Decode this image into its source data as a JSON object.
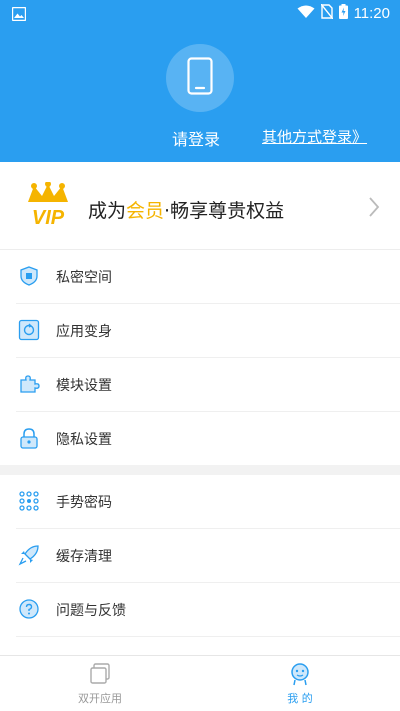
{
  "statusbar": {
    "time": "11:20"
  },
  "header": {
    "login_label": "请登录",
    "other_login_label": "其他方式登录》"
  },
  "vip": {
    "prefix": "成为",
    "highlight": "会员",
    "suffix": "·畅享尊贵权益",
    "badge_text": "VIP"
  },
  "menu": [
    {
      "label": "私密空间",
      "icon": "private-space-icon"
    },
    {
      "label": "应用变身",
      "icon": "app-disguise-icon"
    },
    {
      "label": "模块设置",
      "icon": "puzzle-icon"
    },
    {
      "label": "隐私设置",
      "icon": "lock-icon"
    },
    {
      "label": "手势密码",
      "icon": "gesture-icon"
    },
    {
      "label": "缓存清理",
      "icon": "rocket-icon"
    },
    {
      "label": "问题与反馈",
      "icon": "feedback-icon"
    }
  ],
  "bottomnav": {
    "tabs": [
      {
        "label": "双开应用",
        "active": false
      },
      {
        "label": "我 的",
        "active": true
      }
    ]
  },
  "colors": {
    "primary": "#2a9ef0",
    "vip_gold": "#f5b400",
    "text": "#333333",
    "inactive": "#999999"
  }
}
